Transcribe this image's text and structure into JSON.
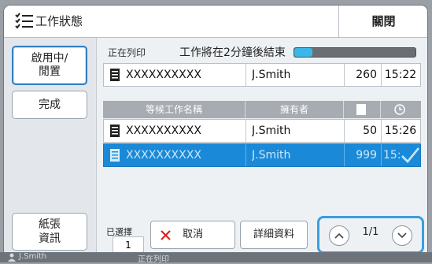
{
  "window": {
    "title": "工作狀態",
    "close_label": "關閉"
  },
  "sidebar": {
    "items": [
      {
        "label": "啟用中/\n閒置",
        "active": true
      },
      {
        "label": "完成",
        "active": false
      },
      {
        "label": "紙張\n資訊",
        "active": false
      }
    ]
  },
  "current_job": {
    "label": "正在列印",
    "status_text": "工作將在2分鐘後結束",
    "progress_fraction": 0.15,
    "name": "XXXXXXXXXX",
    "owner": "J.Smith",
    "pages": "260",
    "time": "15:22"
  },
  "queue": {
    "columns": [
      "等候工作名稱",
      "擁有者",
      "page-icon",
      "clock-icon"
    ],
    "rows": [
      {
        "name": "XXXXXXXXXX",
        "owner": "J.Smith",
        "pages": "50",
        "time": "15:26",
        "selected": false
      },
      {
        "name": "XXXXXXXXXX",
        "owner": "J.Smith",
        "pages": "999",
        "time": "15:",
        "selected": true
      }
    ]
  },
  "footer": {
    "selected_label": "已選擇",
    "selected_count": "1",
    "cancel_label": "取消",
    "details_label": "詳細資料",
    "page_indicator": "1/1"
  },
  "statusbar": {
    "user": "J.Smith",
    "status": "正在列印"
  },
  "colors": {
    "accent": "#1a8ad8",
    "progress": "#3bb6e8",
    "highlight": "#3a9ee0",
    "cancel": "#e02020"
  }
}
